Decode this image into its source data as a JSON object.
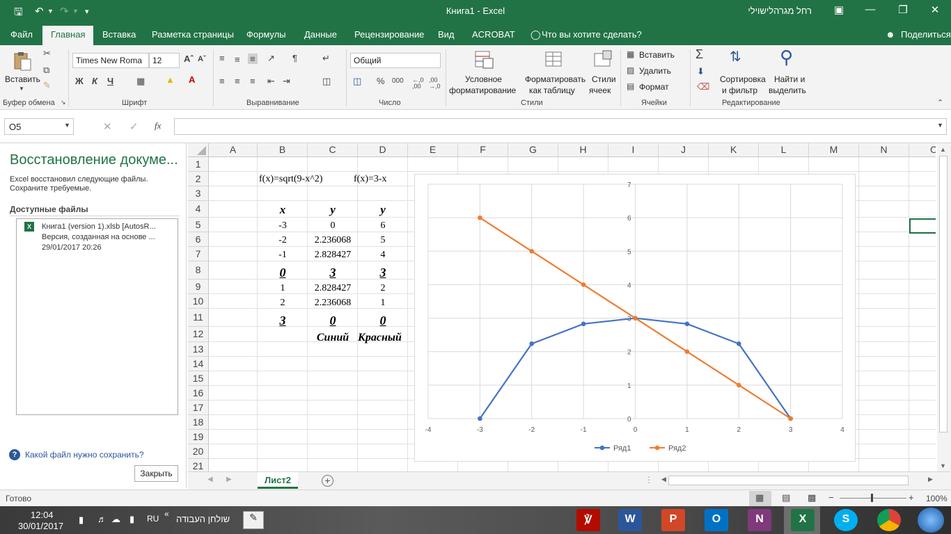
{
  "window": {
    "title": "Книга1  -  Excel",
    "user": "רחל מגרהלישוילי"
  },
  "tabs": [
    "Файл",
    "Главная",
    "Вставка",
    "Разметка страницы",
    "Формулы",
    "Данные",
    "Рецензирование",
    "Вид",
    "ACROBAT"
  ],
  "tell_me": "Что вы хотите сделать?",
  "share": "Поделиться",
  "ribbon": {
    "paste": "Вставить",
    "font_name": "Times New Roma",
    "font_size": "12",
    "bold": "Ж",
    "italic": "К",
    "underline": "Ч",
    "number_format": "Общий",
    "percent": "%",
    "thousands": "000",
    "dec_increase": "←,0 ,00",
    "dec_decrease": ",00 →,0",
    "cond_format": [
      "Условное",
      "форматирование"
    ],
    "format_table": [
      "Форматировать",
      "как таблицу"
    ],
    "cell_styles": [
      "Стили",
      "ячеек"
    ],
    "insert": "Вставить",
    "delete": "Удалить",
    "format": "Формат",
    "sort_filter": [
      "Сортировка",
      "и фильтр"
    ],
    "find_select": [
      "Найти и",
      "выделить"
    ],
    "groups": [
      "Буфер обмена",
      "Шрифт",
      "Выравнивание",
      "Число",
      "Стили",
      "Ячейки",
      "Редактирование"
    ]
  },
  "name_box": "O5",
  "fx": "fx",
  "recovery": {
    "title": "Восстановление докуме...",
    "desc": "Excel восстановил следующие файлы. Сохраните требуемые.",
    "available": "Доступные файлы",
    "file_name": "Книга1 (version 1).xlsb  [AutosR...",
    "file_version": "Версия, созданная на основе ...",
    "file_date": "29/01/2017 20:26",
    "help": "Какой файл нужно сохранить?",
    "close": "Закрыть"
  },
  "grid": {
    "columns": [
      "A",
      "B",
      "C",
      "D",
      "E",
      "F",
      "G",
      "H",
      "I",
      "J",
      "K",
      "L",
      "M",
      "N",
      "O"
    ],
    "rows": [
      "1",
      "2",
      "3",
      "4",
      "5",
      "6",
      "7",
      "8",
      "9",
      "10",
      "11",
      "12",
      "13",
      "14",
      "15",
      "16",
      "17",
      "18",
      "19",
      "20",
      "21"
    ],
    "f1": "f(x)=sqrt(9-x^2)",
    "f2": "f(x)=3-x",
    "hdr_x": "x",
    "hdr_y1": "y",
    "hdr_y2": "y",
    "b5": "-3",
    "c5": "0",
    "d5": "6",
    "b6": "-2",
    "c6": "2.236068",
    "d6": "5",
    "b7": "-1",
    "c7": "2.828427",
    "d7": "4",
    "b8": "0",
    "c8": "3",
    "d8": "3",
    "b9": "1",
    "c9": "2.828427",
    "d9": "2",
    "b10": "2",
    "c10": "2.236068",
    "d10": "1",
    "b11": "3",
    "c11": "0",
    "d11": "0",
    "c12": "Синий",
    "d12": "Красный"
  },
  "chart_data": {
    "type": "scatter",
    "xlim": [
      -4,
      4
    ],
    "ylim": [
      0,
      7
    ],
    "xticks": [
      "-4",
      "-3",
      "-2",
      "-1",
      "0",
      "1",
      "2",
      "3",
      "4"
    ],
    "yticks": [
      "0",
      "1",
      "2",
      "3",
      "4",
      "5",
      "6",
      "7"
    ],
    "grid": true,
    "legend": "bottom",
    "series": [
      {
        "name": "Ряд1",
        "color": "#4472c4",
        "x": [
          -3,
          -2,
          -1,
          0,
          1,
          2,
          3
        ],
        "y": [
          0,
          2.236068,
          2.828427,
          3,
          2.828427,
          2.236068,
          0
        ]
      },
      {
        "name": "Ряд2",
        "color": "#ed7d31",
        "x": [
          -3,
          -2,
          -1,
          0,
          1,
          2,
          3
        ],
        "y": [
          6,
          5,
          4,
          3,
          2,
          1,
          0
        ]
      }
    ]
  },
  "sheet_tab": "Лист2",
  "status": {
    "ready": "Готово",
    "zoom": "100%"
  },
  "taskbar": {
    "time": "12:04",
    "date": "30/01/2017",
    "lang": "RU",
    "desktop": "שולחן העבודה"
  },
  "colors": {
    "accent": "#217346"
  }
}
